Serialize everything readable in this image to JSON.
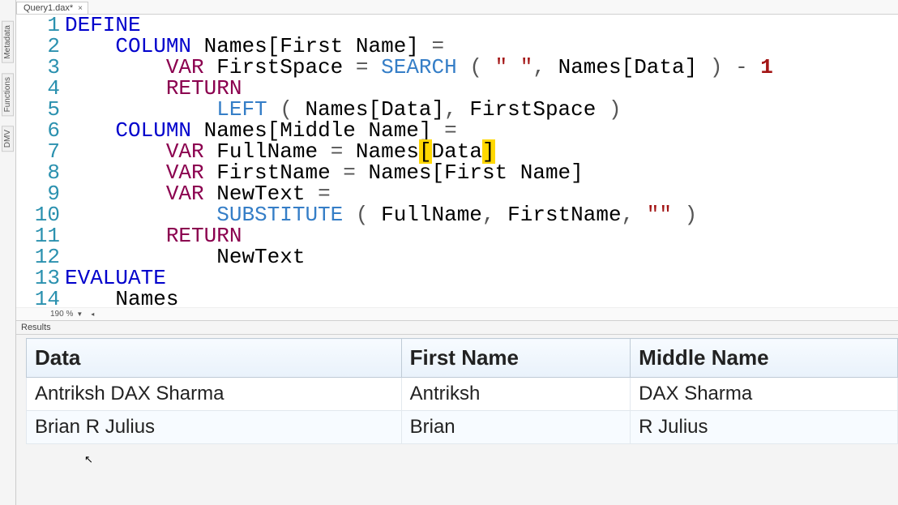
{
  "tab": {
    "title": "Query1.dax*",
    "close": "×"
  },
  "side_tabs": [
    "Metadata",
    "Functions",
    "DMV"
  ],
  "zoom": {
    "label": "190 %"
  },
  "results_header": "Results",
  "code": {
    "lines": [
      {
        "n": "1",
        "raw": [
          [
            "kw",
            "DEFINE"
          ]
        ]
      },
      {
        "n": "2",
        "raw": [
          [
            "sp",
            "    "
          ],
          [
            "kw",
            "COLUMN"
          ],
          [
            "sp",
            " "
          ],
          [
            "ident",
            "Names[First Name]"
          ],
          [
            "sp",
            " "
          ],
          [
            "punc",
            "="
          ]
        ]
      },
      {
        "n": "3",
        "raw": [
          [
            "sp",
            "        "
          ],
          [
            "kw2",
            "VAR"
          ],
          [
            "sp",
            " "
          ],
          [
            "ident",
            "FirstSpace"
          ],
          [
            "sp",
            " "
          ],
          [
            "punc",
            "="
          ],
          [
            "sp",
            " "
          ],
          [
            "fn",
            "SEARCH"
          ],
          [
            "sp",
            " "
          ],
          [
            "punc",
            "("
          ],
          [
            "sp",
            " "
          ],
          [
            "str",
            "\" \""
          ],
          [
            "punc",
            ","
          ],
          [
            "sp",
            " "
          ],
          [
            "ident",
            "Names[Data]"
          ],
          [
            "sp",
            " "
          ],
          [
            "punc",
            ")"
          ],
          [
            "sp",
            " "
          ],
          [
            "punc",
            "-"
          ],
          [
            "sp",
            " "
          ],
          [
            "num",
            "1"
          ]
        ]
      },
      {
        "n": "4",
        "raw": [
          [
            "sp",
            "        "
          ],
          [
            "kw2",
            "RETURN"
          ]
        ]
      },
      {
        "n": "5",
        "raw": [
          [
            "sp",
            "            "
          ],
          [
            "fn",
            "LEFT"
          ],
          [
            "sp",
            " "
          ],
          [
            "punc",
            "("
          ],
          [
            "sp",
            " "
          ],
          [
            "ident",
            "Names[Data]"
          ],
          [
            "punc",
            ","
          ],
          [
            "sp",
            " "
          ],
          [
            "ident",
            "FirstSpace"
          ],
          [
            "sp",
            " "
          ],
          [
            "punc",
            ")"
          ]
        ]
      },
      {
        "n": "6",
        "raw": [
          [
            "sp",
            "    "
          ],
          [
            "kw",
            "COLUMN"
          ],
          [
            "sp",
            " "
          ],
          [
            "ident",
            "Names[Middle Name]"
          ],
          [
            "sp",
            " "
          ],
          [
            "punc",
            "="
          ]
        ]
      },
      {
        "n": "7",
        "raw": [
          [
            "sp",
            "        "
          ],
          [
            "kw2",
            "VAR"
          ],
          [
            "sp",
            " "
          ],
          [
            "ident",
            "FullName"
          ],
          [
            "sp",
            " "
          ],
          [
            "punc",
            "="
          ],
          [
            "sp",
            " "
          ],
          [
            "ident",
            "Names"
          ],
          [
            "hl",
            "["
          ],
          [
            "ident",
            "Data"
          ],
          [
            "hl",
            "]"
          ]
        ]
      },
      {
        "n": "8",
        "raw": [
          [
            "sp",
            "        "
          ],
          [
            "kw2",
            "VAR"
          ],
          [
            "sp",
            " "
          ],
          [
            "ident",
            "FirstName"
          ],
          [
            "sp",
            " "
          ],
          [
            "punc",
            "="
          ],
          [
            "sp",
            " "
          ],
          [
            "ident",
            "Names[First Name]"
          ]
        ]
      },
      {
        "n": "9",
        "raw": [
          [
            "sp",
            "        "
          ],
          [
            "kw2",
            "VAR"
          ],
          [
            "sp",
            " "
          ],
          [
            "ident",
            "NewText"
          ],
          [
            "sp",
            " "
          ],
          [
            "punc",
            "="
          ]
        ]
      },
      {
        "n": "10",
        "raw": [
          [
            "sp",
            "            "
          ],
          [
            "fn",
            "SUBSTITUTE"
          ],
          [
            "sp",
            " "
          ],
          [
            "punc",
            "("
          ],
          [
            "sp",
            " "
          ],
          [
            "ident",
            "FullName"
          ],
          [
            "punc",
            ","
          ],
          [
            "sp",
            " "
          ],
          [
            "ident",
            "FirstName"
          ],
          [
            "punc",
            ","
          ],
          [
            "sp",
            " "
          ],
          [
            "str",
            "\"\""
          ],
          [
            "sp",
            " "
          ],
          [
            "punc",
            ")"
          ]
        ]
      },
      {
        "n": "11",
        "raw": [
          [
            "sp",
            "        "
          ],
          [
            "kw2",
            "RETURN"
          ]
        ]
      },
      {
        "n": "12",
        "raw": [
          [
            "sp",
            "            "
          ],
          [
            "ident",
            "NewText"
          ]
        ]
      },
      {
        "n": "13",
        "raw": [
          [
            "kw",
            "EVALUATE"
          ]
        ]
      },
      {
        "n": "14",
        "raw": [
          [
            "sp",
            "    "
          ],
          [
            "ident",
            "Names"
          ]
        ]
      }
    ]
  },
  "grid": {
    "columns": [
      "Data",
      "First Name",
      "Middle Name"
    ],
    "rows": [
      [
        "Antriksh DAX Sharma",
        "Antriksh",
        "DAX Sharma"
      ],
      [
        "Brian R Julius",
        "Brian",
        "R Julius"
      ]
    ]
  }
}
